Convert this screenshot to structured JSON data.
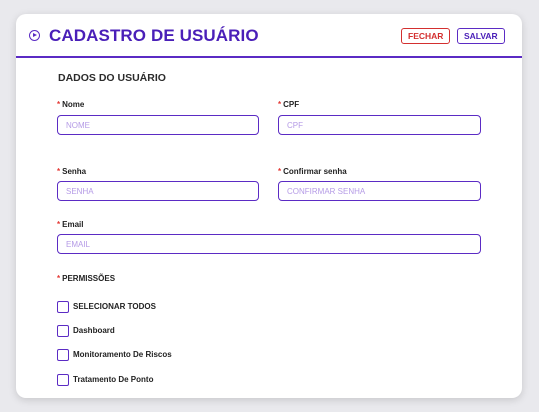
{
  "header": {
    "title": "CADASTRO DE USUÁRIO",
    "close_label": "FECHAR",
    "save_label": "SALVAR",
    "icon": "chevron-circle-icon"
  },
  "section": {
    "title": "DADOS DO USUÁRIO"
  },
  "fields": {
    "nome": {
      "label": "Nome",
      "placeholder": "NOME",
      "value": ""
    },
    "cpf": {
      "label": "CPF",
      "placeholder": "CPF",
      "value": ""
    },
    "senha": {
      "label": "Senha",
      "placeholder": "SENHA",
      "value": ""
    },
    "confirmar_senha": {
      "label": "Confirmar senha",
      "placeholder": "CONFIRMAR SENHA",
      "value": ""
    },
    "email": {
      "label": "Email",
      "placeholder": "EMAIL",
      "value": ""
    }
  },
  "required_mark": "*",
  "permissions": {
    "title": "PERMISSÕES",
    "items": [
      {
        "label": "SELECIONAR TODOS",
        "checked": false
      },
      {
        "label": "Dashboard",
        "checked": false
      },
      {
        "label": "Monitoramento De Riscos",
        "checked": false
      },
      {
        "label": "Tratamento De Ponto",
        "checked": false
      }
    ]
  },
  "colors": {
    "accent": "#5b2bc4",
    "title": "#4a1fb8",
    "danger": "#d32f2f",
    "required": "#e53935",
    "placeholder": "#b59be6"
  }
}
